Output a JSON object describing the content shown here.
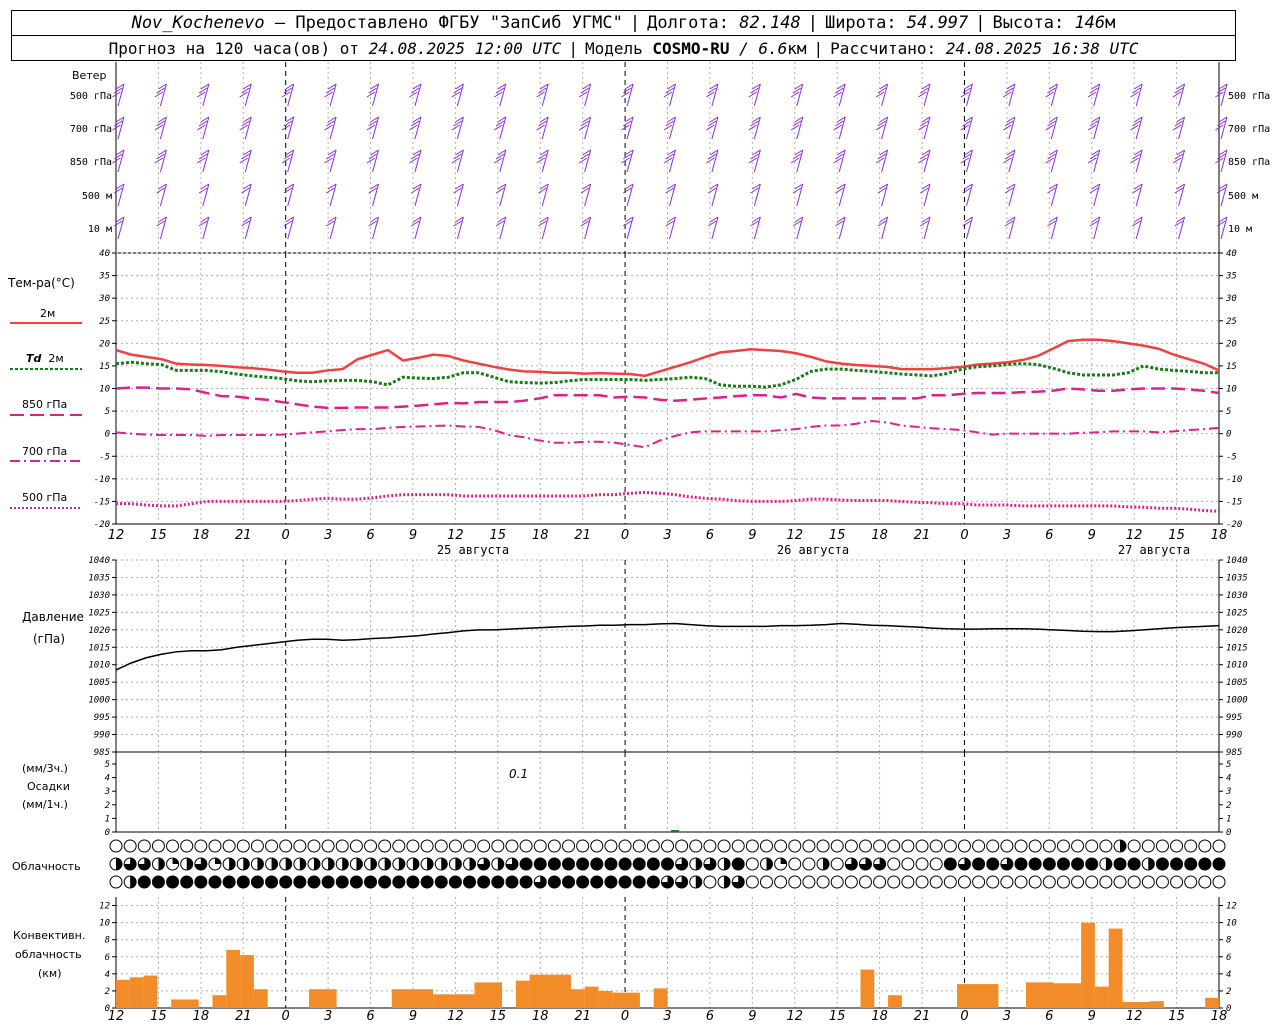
{
  "header": {
    "station": "Nov_Kochenevo",
    "provided": "— Предоставлено ФГБУ \"ЗапСиб УГМС\"",
    "lon_label": "Долгота:",
    "lon": "82.148",
    "lat_label": "Широта:",
    "lat": "54.997",
    "alt_label": "Высота:",
    "alt": "146",
    "alt_unit": "м"
  },
  "subheader": {
    "forecast": "Прогноз на 120 часа(ов) от",
    "init": "24.08.2025 12:00 UTC",
    "model_label": "Модель",
    "model": "COSMO-RU",
    "res": "/ 6.6",
    "res_unit": "км",
    "calc_label": "Рассчитано:",
    "calc": "24.08.2025 16:38 UTC"
  },
  "labels": {
    "wind": "Ветер",
    "wind_levels": [
      "500 гПа",
      "700 гПа",
      "850 гПа",
      "500 м",
      "10 м"
    ],
    "temp": "Тем-ра(°C)",
    "t2m": "2м",
    "td": "Td",
    "td2m": "2м",
    "t850": "850 гПа",
    "t700": "700 гПа",
    "t500": "500 гПа",
    "pressure": "Давление",
    "pressure_unit": "(гПа)",
    "precip_3h": "(мм/3ч.)",
    "precip": "Осадки",
    "precip_1h": "(мм/1ч.)",
    "precip_annotation": "0.1",
    "clouds": "Облачность",
    "conv1": "Конвективн.",
    "conv2": "облачность",
    "conv3": "(км)"
  },
  "colors": {
    "wind": "#8a2be2",
    "t2m": "#f04040",
    "td": "#1a7a1a",
    "t850": "#e0208a",
    "t700": "#e0208a",
    "t500": "#e0208a",
    "pressure": "#000000",
    "conv": "#f28c28",
    "grid": "#b0b0b0"
  },
  "chart_data": {
    "type": "line",
    "x_hour_ticks": [
      "12",
      "15",
      "18",
      "21",
      "0",
      "3",
      "6",
      "9",
      "12",
      "15",
      "18",
      "21",
      "0",
      "3",
      "6",
      "9",
      "12",
      "15",
      "18",
      "21",
      "0",
      "3",
      "6",
      "9",
      "12",
      "15",
      "18"
    ],
    "date_labels": [
      "25 августа",
      "26 августа",
      "27 августа"
    ],
    "temp_axis": {
      "ylim": [
        -20,
        40
      ],
      "ticks": [
        "40",
        "35",
        "30",
        "25",
        "20",
        "15",
        "10",
        "5",
        "0",
        "-5",
        "-10",
        "-15",
        "-20"
      ]
    },
    "pressure_axis": {
      "ylim": [
        985,
        1040
      ],
      "ticks": [
        "1040",
        "1035",
        "1030",
        "1025",
        "1020",
        "1015",
        "1010",
        "1005",
        "1000",
        "995",
        "990",
        "985"
      ]
    },
    "precip_axis": {
      "ylim": [
        0,
        5
      ],
      "ticks": [
        "5",
        "4",
        "3",
        "2",
        "1",
        "0"
      ]
    },
    "conv_axis": {
      "ylim": [
        0,
        13
      ],
      "ticks": [
        "12",
        "10",
        "8",
        "6",
        "4",
        "2",
        "0"
      ]
    },
    "series": [
      {
        "name": "2м",
        "key": "t2m",
        "values": [
          18.5,
          17.5,
          17,
          16.5,
          15.5,
          15.3,
          15.2,
          15,
          14.7,
          14.5,
          14.2,
          13.8,
          13.5,
          13.5,
          14,
          14.3,
          16.5,
          17.5,
          18.5,
          16.2,
          16.8,
          17.5,
          17.2,
          16.2,
          15.5,
          14.8,
          14.2,
          13.8,
          13.7,
          13.5,
          13.5,
          13.3,
          13.4,
          13.3,
          13.2,
          12.8,
          13.8,
          14.8,
          15.8,
          17,
          18,
          18.3,
          18.7,
          18.5,
          18.3,
          17.8,
          17,
          16,
          15.5,
          15.2,
          15,
          14.8,
          14.3,
          14.3,
          14.3,
          14.5,
          14.8,
          15.3,
          15.5,
          15.8,
          16.3,
          17.2,
          18.8,
          20.5,
          20.8,
          20.8,
          20.5,
          20,
          19.5,
          18.8,
          17.5,
          16.5,
          15.5,
          14
        ]
      },
      {
        "name": "Td 2м",
        "key": "td",
        "values": [
          15.5,
          15.8,
          15.5,
          15.3,
          14,
          14,
          14,
          13.7,
          13.2,
          12.8,
          12.5,
          12.2,
          11.7,
          11.5,
          11.7,
          11.8,
          11.8,
          11.5,
          10.8,
          12.5,
          12.3,
          12.2,
          12.5,
          13.5,
          13.5,
          12.5,
          11.5,
          11.3,
          11.2,
          11.3,
          11.7,
          12,
          12,
          12,
          12,
          11.8,
          12,
          12.2,
          12.5,
          12.2,
          10.8,
          10.5,
          10.5,
          10.3,
          10.8,
          12,
          13.8,
          14.3,
          14.3,
          14,
          13.8,
          13.5,
          13.2,
          13,
          12.8,
          13.3,
          14.3,
          14.8,
          15,
          15.3,
          15.5,
          15.3,
          14.5,
          13.5,
          13,
          13,
          13,
          13.5,
          15,
          14.3,
          14,
          13.8,
          13.5,
          13.5
        ]
      },
      {
        "name": "850 гПа",
        "key": "t850",
        "values": [
          10,
          10.2,
          10.2,
          10,
          10,
          9.8,
          9,
          8.3,
          8.2,
          7.8,
          7.5,
          7,
          6.5,
          6,
          5.7,
          5.7,
          5.8,
          5.8,
          5.8,
          6,
          6.2,
          6.5,
          6.8,
          6.7,
          7,
          7,
          7,
          7.3,
          7.8,
          8.5,
          8.5,
          8.5,
          8.5,
          8,
          8.2,
          8,
          7.5,
          7.3,
          7.5,
          7.8,
          8,
          8.3,
          8.5,
          8.5,
          8,
          8.8,
          8,
          7.8,
          7.8,
          7.8,
          7.8,
          7.8,
          7.8,
          7.8,
          8.5,
          8.5,
          8.8,
          9,
          9,
          9,
          9.2,
          9.3,
          9.5,
          10,
          9.8,
          9.5,
          9.5,
          9.8,
          10,
          10,
          10,
          9.8,
          9.5,
          9
        ]
      },
      {
        "name": "700 гПа",
        "key": "t700",
        "values": [
          0.3,
          0,
          -0.2,
          -0.3,
          -0.3,
          -0.3,
          -0.5,
          -0.3,
          -0.3,
          -0.3,
          -0.3,
          -0.2,
          0,
          0.3,
          0.5,
          0.8,
          1,
          1,
          1.3,
          1.5,
          1.6,
          1.7,
          1.8,
          1.6,
          1.5,
          0.8,
          -0.3,
          -0.8,
          -1.5,
          -2,
          -2,
          -1.8,
          -1.8,
          -2,
          -2.5,
          -3,
          -1.5,
          -0.5,
          0.3,
          0.5,
          0.5,
          0.5,
          0.5,
          0.5,
          0.8,
          1,
          1.5,
          1.8,
          1.8,
          2.2,
          2.8,
          2.5,
          1.8,
          1.5,
          1.2,
          1,
          0.8,
          0.3,
          -0.2,
          0,
          0,
          0,
          0,
          0,
          0.2,
          0.3,
          0.5,
          0.5,
          0.5,
          0.3,
          0.5,
          0.8,
          1,
          1.3
        ]
      },
      {
        "name": "500 гПа",
        "key": "t500",
        "values": [
          -15.5,
          -15.5,
          -15.8,
          -16,
          -16,
          -15.5,
          -15,
          -15,
          -15,
          -15,
          -15,
          -15,
          -14.8,
          -14.5,
          -14.3,
          -14.5,
          -14.5,
          -14.2,
          -13.8,
          -13.5,
          -13.5,
          -13.5,
          -13.5,
          -13.8,
          -13.8,
          -13.8,
          -13.8,
          -13.8,
          -13.8,
          -13.8,
          -13.8,
          -13.8,
          -13.5,
          -13.5,
          -13.2,
          -13,
          -13.2,
          -13.5,
          -14,
          -14.3,
          -14.5,
          -14.8,
          -15,
          -15,
          -15,
          -14.8,
          -14.5,
          -14.5,
          -14.7,
          -14.8,
          -14.8,
          -14.8,
          -15,
          -15.2,
          -15.3,
          -15.5,
          -15.5,
          -15.8,
          -15.8,
          -15.8,
          -16,
          -16,
          -16,
          -16,
          -16,
          -16,
          -16,
          -16.2,
          -16.3,
          -16.5,
          -16.5,
          -16.7,
          -17,
          -17.2
        ]
      },
      {
        "name": "Давление",
        "key": "pressure",
        "values": [
          1008.5,
          1010.5,
          1012,
          1013,
          1013.7,
          1014,
          1014,
          1014.3,
          1015,
          1015.5,
          1016,
          1016.5,
          1017,
          1017.3,
          1017.3,
          1017,
          1017.2,
          1017.5,
          1017.7,
          1018,
          1018.3,
          1018.8,
          1019.2,
          1019.7,
          1020,
          1020,
          1020.2,
          1020.4,
          1020.6,
          1020.8,
          1021,
          1021.1,
          1021.3,
          1021.3,
          1021.5,
          1021.5,
          1021.7,
          1021.8,
          1021.5,
          1021.2,
          1021,
          1021,
          1021,
          1021,
          1021.2,
          1021.2,
          1021.3,
          1021.5,
          1021.8,
          1021.6,
          1021.3,
          1021.2,
          1021,
          1020.8,
          1020.5,
          1020.3,
          1020.2,
          1020.2,
          1020.3,
          1020.3,
          1020.3,
          1020.2,
          1020,
          1019.8,
          1019.6,
          1019.5,
          1019.5,
          1019.7,
          1020,
          1020.3,
          1020.6,
          1020.8,
          1021,
          1021.2
        ]
      }
    ],
    "precip_values": {
      "x": [
        37
      ],
      "values": [
        0.1
      ]
    },
    "conv_bars": [
      {
        "x": [
          0,
          1
        ],
        "values": [
          3.3
        ]
      },
      {
        "x": [
          1,
          2
        ],
        "values": [
          3.6
        ]
      },
      {
        "x": [
          2,
          3
        ],
        "values": [
          3.8
        ]
      },
      {
        "x": [
          4,
          6
        ],
        "values": [
          1
        ]
      },
      {
        "x": [
          7,
          8
        ],
        "values": [
          1.5
        ]
      },
      {
        "x": [
          8,
          9
        ],
        "values": [
          6.8
        ]
      },
      {
        "x": [
          9,
          10
        ],
        "values": [
          6.2
        ]
      },
      {
        "x": [
          10,
          11
        ],
        "values": [
          2.2
        ]
      },
      {
        "x": [
          14,
          16
        ],
        "values": [
          2.2
        ]
      },
      {
        "x": [
          20,
          21
        ],
        "values": [
          2.2
        ]
      },
      {
        "x": [
          21,
          23
        ],
        "values": [
          2.2
        ]
      },
      {
        "x": [
          23,
          26
        ],
        "values": [
          1.6
        ]
      },
      {
        "x": [
          26,
          28
        ],
        "values": [
          3
        ]
      },
      {
        "x": [
          29,
          30
        ],
        "values": [
          3.2
        ]
      },
      {
        "x": [
          30,
          33
        ],
        "values": [
          3.9
        ]
      },
      {
        "x": [
          33,
          34
        ],
        "values": [
          2.2
        ]
      },
      {
        "x": [
          34,
          35
        ],
        "values": [
          2.5
        ]
      },
      {
        "x": [
          35,
          36
        ],
        "values": [
          2
        ]
      },
      {
        "x": [
          36,
          38
        ],
        "values": [
          1.8
        ]
      },
      {
        "x": [
          39,
          40
        ],
        "values": [
          2.3
        ]
      },
      {
        "x": [
          54,
          55
        ],
        "values": [
          4.5
        ]
      },
      {
        "x": [
          56,
          57
        ],
        "values": [
          1.5
        ]
      },
      {
        "x": [
          61,
          64
        ],
        "values": [
          2.8
        ]
      },
      {
        "x": [
          66,
          68
        ],
        "values": [
          3
        ]
      },
      {
        "x": [
          68,
          70
        ],
        "values": [
          2.9
        ]
      },
      {
        "x": [
          70,
          71
        ],
        "values": [
          10
        ]
      },
      {
        "x": [
          71,
          72
        ],
        "values": [
          2.5
        ]
      },
      {
        "x": [
          72,
          73
        ],
        "values": [
          9.3
        ]
      },
      {
        "x": [
          73,
          75
        ],
        "values": [
          0.7
        ]
      },
      {
        "x": [
          75,
          76
        ],
        "values": [
          0.8
        ]
      },
      {
        "x": [
          79,
          80
        ],
        "values": [
          1.2
        ]
      }
    ],
    "cloud_rows": {
      "note": "cloud cover per 1h step, 0-4 quarters, three rows",
      "upper": [
        0,
        0,
        0,
        0,
        0,
        0,
        0,
        0,
        0,
        0,
        0,
        0,
        0,
        0,
        0,
        0,
        0,
        0,
        0,
        0,
        0,
        0,
        0,
        0,
        0,
        0,
        0,
        0,
        0,
        0,
        0,
        0,
        0,
        0,
        0,
        0,
        0,
        0,
        0,
        0,
        0,
        0,
        0,
        0,
        0,
        0,
        0,
        0,
        0,
        0,
        0,
        0,
        0,
        0,
        0,
        0,
        0,
        0,
        0,
        0,
        0,
        0,
        0,
        0,
        0,
        0,
        0,
        0,
        0,
        0,
        0,
        2,
        0,
        0,
        0,
        0,
        0,
        0,
        0,
        0,
        0,
        0,
        0,
        0,
        0,
        0,
        0,
        0,
        0,
        4,
        4,
        4,
        3,
        4,
        0,
        0,
        0,
        0,
        0,
        1,
        0,
        0,
        0,
        3,
        3,
        2,
        2,
        2,
        4,
        4,
        2,
        1,
        0,
        0,
        0,
        0,
        0,
        0
      ],
      "middle": [
        2,
        3,
        3,
        2,
        1,
        2,
        3,
        1,
        2,
        2,
        2,
        2,
        2,
        2,
        2,
        2,
        2,
        2,
        2,
        2,
        2,
        2,
        2,
        2,
        2,
        2,
        3,
        2,
        3,
        4,
        4,
        4,
        4,
        4,
        4,
        4,
        4,
        4,
        4,
        4,
        3,
        2,
        3,
        2,
        4,
        0,
        2,
        1,
        0,
        0,
        2,
        0,
        3,
        3,
        3,
        0,
        0,
        0,
        0,
        4,
        3,
        4,
        4,
        3,
        4,
        4,
        4,
        4,
        4,
        4,
        2,
        4,
        4,
        2,
        4,
        4,
        4,
        4,
        4,
        4,
        4,
        1,
        2,
        2,
        2,
        0,
        0,
        0,
        0,
        0,
        0,
        0,
        0,
        0,
        0,
        0,
        0,
        0,
        0,
        0,
        0,
        0,
        0,
        0,
        2,
        4,
        4,
        4,
        4,
        4,
        4,
        4,
        4,
        4,
        4,
        4,
        3,
        2,
        0,
        0
      ],
      "lower": [
        0,
        2,
        4,
        4,
        4,
        4,
        4,
        4,
        4,
        4,
        4,
        4,
        4,
        4,
        4,
        4,
        4,
        4,
        4,
        4,
        4,
        4,
        4,
        4,
        4,
        4,
        4,
        4,
        4,
        4,
        3,
        4,
        4,
        4,
        4,
        4,
        4,
        4,
        4,
        3,
        3,
        2,
        0,
        2,
        3,
        0,
        0,
        0,
        0,
        0,
        0,
        0,
        0,
        0,
        0,
        0,
        0,
        0,
        0,
        0,
        0,
        0,
        0,
        0,
        0,
        0,
        0,
        0,
        0,
        0,
        0,
        0,
        0,
        0,
        0,
        0,
        0,
        0,
        0,
        0,
        0,
        0,
        0,
        0,
        0,
        0,
        0,
        0,
        0,
        0,
        0,
        0,
        0,
        0,
        0,
        0,
        0,
        0,
        0,
        0,
        0,
        0,
        0,
        0,
        0,
        0,
        0,
        0,
        0,
        0,
        0,
        0,
        0,
        0,
        0,
        0,
        0,
        0,
        0,
        0
      ]
    }
  }
}
